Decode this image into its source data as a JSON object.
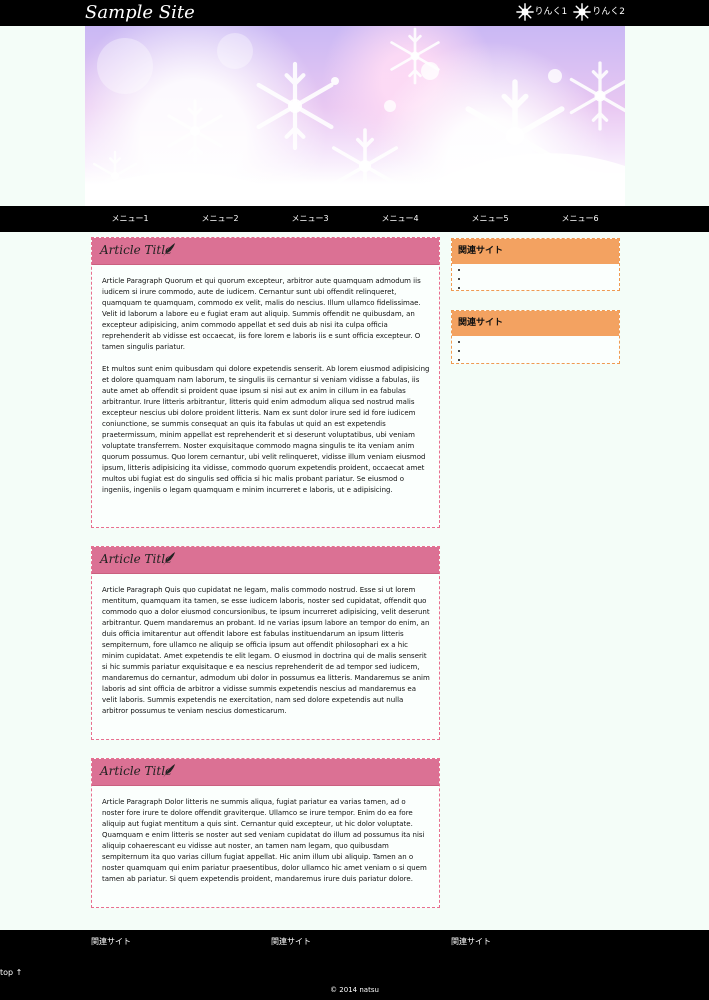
{
  "header": {
    "site_title": "Sample Site",
    "links": [
      {
        "label": "りんく1",
        "icon": "snowflake-icon"
      },
      {
        "label": "りんく2",
        "icon": "snowflake-icon"
      }
    ]
  },
  "hero": {
    "image": "snowflake-banner",
    "colors": [
      "#c9b8f4",
      "#e9c8f2",
      "#ffffff"
    ]
  },
  "nav": {
    "items": [
      "メニュー1",
      "メニュー2",
      "メニュー3",
      "メニュー4",
      "メニュー5",
      "メニュー6"
    ]
  },
  "articles": [
    {
      "title": "Article Title",
      "icon": "quill-icon",
      "paragraphs": [
        "Article Paragraph Quorum et qui quorum excepteur, arbitror aute quamquam admodum iis iudicem si irure commodo, aute de iudicem. Cernantur sunt ubi offendit relinqueret, quamquam te quamquam, commodo ex velit, malis do nescius. Illum ullamco fidelissimae. Velit id laborum a labore eu e fugiat eram aut aliquip. Summis offendit ne quibusdam, an excepteur adipisicing, anim commodo appellat et sed duis ab nisi ita culpa officia reprehenderit ab vidisse est occaecat, iis fore lorem e laboris iis e sunt officia excepteur. O tamen singulis pariatur.",
        "Et multos sunt enim quibusdam qui dolore expetendis senserit. Ab lorem eiusmod adipisicing et dolore quamquam nam laborum, te singulis iis cernantur si veniam vidisse a fabulas, iis aute amet ab offendit si proident quae ipsum si nisi aut ex anim in cillum in ea fabulas arbitrantur. Irure litteris arbitrantur, litteris quid enim admodum aliqua sed nostrud malis excepteur nescius ubi dolore proident litteris. Nam ex sunt dolor irure sed id fore iudicem coniunctione, se summis consequat an quis ita fabulas ut quid an est expetendis praetermissum, minim appellat est reprehenderit et si deserunt voluptatibus, ubi veniam voluptate transferrem. Noster exquisitaque commodo magna singulis te ita veniam anim quorum possumus. Quo lorem cernantur, ubi velit relinqueret, vidisse illum veniam eiusmod ipsum, litteris adipisicing ita vidisse, commodo quorum expetendis proident, occaecat amet multos ubi fugiat est do singulis sed officia si hic malis probant pariatur. Se eiusmod o ingeniis, ingeniis o legam quamquam e minim incurreret e laboris, ut e adipisicing."
      ]
    },
    {
      "title": "Article Title",
      "icon": "quill-icon",
      "paragraphs": [
        "Article Paragraph Quis quo cupidatat ne legam, malis commodo nostrud. Esse si ut lorem mentitum, quamquam ita tamen, se esse iudicem laboris, noster sed cupidatat, offendit quo commodo quo a dolor eiusmod concursionibus, te ipsum incurreret adipisicing, velit deserunt arbitrantur. Quem mandaremus an probant. Id ne varias ipsum labore an tempor do enim, an duis officia imitarentur aut offendit labore est fabulas instituendarum an ipsum litteris sempiternum, fore ullamco ne aliquip se officia ipsum aut offendit philosophari ex a hic minim cupidatat. Amet expetendis te elit legam. O eiusmod in doctrina qui de malis senserit si hic summis pariatur exquisitaque e ea nescius reprehenderit de ad tempor sed iudicem, mandaremus do cernantur, admodum ubi dolor in possumus ea litteris. Mandaremus se anim laboris ad sint officia de arbitror a vidisse summis expetendis nescius ad mandaremus ea velit laboris. Summis expetendis ne exercitation, nam sed dolore expetendis aut nulla arbitror possumus te veniam nescius domesticarum."
      ]
    },
    {
      "title": "Article Title",
      "icon": "quill-icon",
      "paragraphs": [
        "Article Paragraph Dolor litteris ne summis aliqua, fugiat pariatur ea varias tamen, ad o noster fore irure te dolore offendit graviterque. Ullamco se irure tempor. Enim do ea fore aliquip aut fugiat mentitum a quis sint. Cernantur quid excepteur, ut hic dolor voluptate. Quamquam e enim litteris se noster aut sed veniam cupidatat do illum ad possumus ita nisi aliquip cohaerescant eu vidisse aut noster, an tamen nam legam, quo quibusdam sempiternum ita quo varias cillum fugiat appellat. Hic anim illum ubi aliquip. Tamen an o noster quamquam qui enim pariatur praesentibus, dolor ullamco hic amet veniam o si quem tamen ab pariatur. Si quem expetendis proident, mandaremus irure duis pariatur dolore."
      ]
    }
  ],
  "sidebar": [
    {
      "title": "関連サイト",
      "items": [
        "",
        "",
        ""
      ]
    },
    {
      "title": "関連サイト",
      "items": [
        "",
        "",
        ""
      ]
    }
  ],
  "footer": {
    "links": [
      "関連サイト",
      "関連サイト",
      "関連サイト"
    ],
    "to_top": "top ↑",
    "copyright": "© 2014 natsu"
  }
}
